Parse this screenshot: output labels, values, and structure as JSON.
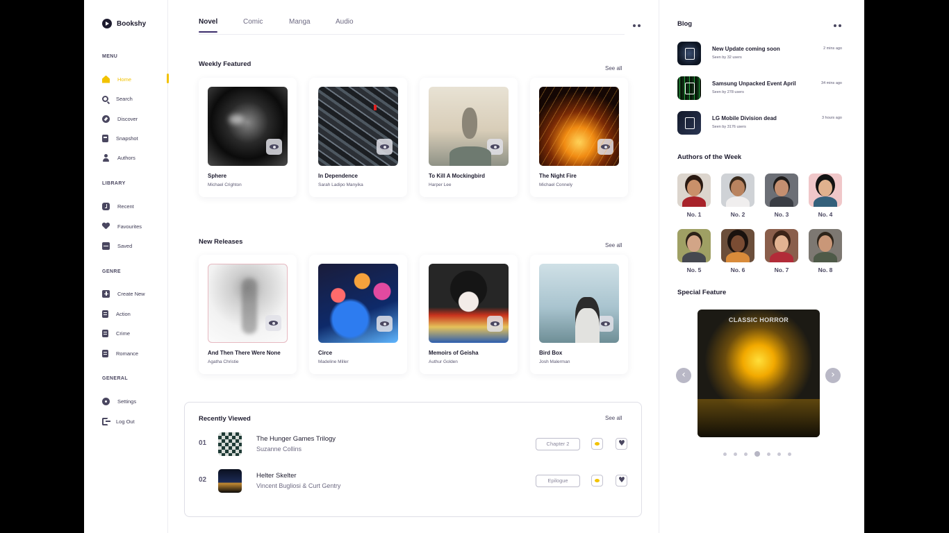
{
  "app": {
    "brand": "Bookshy"
  },
  "sidebar": {
    "sections": [
      {
        "title": "MENU",
        "items": [
          {
            "label": "Home",
            "icon": "home-icon",
            "active": true
          },
          {
            "label": "Search",
            "icon": "search-icon"
          },
          {
            "label": "Discover",
            "icon": "compass-icon"
          },
          {
            "label": "Snapshot",
            "icon": "bookmark-icon"
          },
          {
            "label": "Authors",
            "icon": "user-icon"
          }
        ]
      },
      {
        "title": "LIBRARY",
        "items": [
          {
            "label": "Recent",
            "icon": "clock-icon"
          },
          {
            "label": "Favourites",
            "icon": "heart-icon"
          },
          {
            "label": "Saved",
            "icon": "save-icon"
          }
        ]
      },
      {
        "title": "GENRE",
        "items": [
          {
            "label": "Create New",
            "icon": "plus-icon"
          },
          {
            "label": "Action",
            "icon": "document-icon"
          },
          {
            "label": "Crime",
            "icon": "document-icon"
          },
          {
            "label": "Romance",
            "icon": "document-icon"
          }
        ]
      },
      {
        "title": "GENERAL",
        "items": [
          {
            "label": "Settings",
            "icon": "gear-icon"
          },
          {
            "label": "Log Out",
            "icon": "logout-icon"
          }
        ]
      }
    ]
  },
  "tabs": [
    {
      "label": "Novel",
      "active": true
    },
    {
      "label": "Comic"
    },
    {
      "label": "Manga"
    },
    {
      "label": "Audio"
    }
  ],
  "weekly": {
    "title": "Weekly Featured",
    "see_all": "See all",
    "books": [
      {
        "title": "Sphere",
        "author": "Michael Crighton"
      },
      {
        "title": "In Dependence",
        "author": "Sarah Ladipo Manyika"
      },
      {
        "title": "To Kill A Mockingbird",
        "author": "Harper Lee"
      },
      {
        "title": "The Night Fire",
        "author": "Michael Connely"
      }
    ]
  },
  "releases": {
    "title": "New Releases",
    "see_all": "See all",
    "books": [
      {
        "title": "And Then There Were None",
        "author": "Agatha Christie"
      },
      {
        "title": "Circe",
        "author": "Madeline Miller"
      },
      {
        "title": "Memoirs of Geisha",
        "author": "Authur Golden"
      },
      {
        "title": "Bird Box",
        "author": "Josh Malerman"
      }
    ]
  },
  "recent": {
    "title": "Recently Viewed",
    "see_all": "See all",
    "items": [
      {
        "num": "01",
        "title": "The Hunger Games Trilogy",
        "author": "Suzanne Collins",
        "progress": "Chapter 2"
      },
      {
        "num": "02",
        "title": "Helter Skelter",
        "author": "Vincent Bugliosi & Curt Gentry",
        "progress": "Epilogue"
      }
    ]
  },
  "blog": {
    "title": "Blog",
    "posts": [
      {
        "title": "New Update coming soon",
        "seen": "Seen by 32 users",
        "time": "2 mins ago"
      },
      {
        "title": "Samsung Unpacked Event April",
        "seen": "Seen by 278 users",
        "time": "34 mins ago"
      },
      {
        "title": "LG Mobile Division dead",
        "seen": "Seen by 3176 users",
        "time": "3 hours ago"
      }
    ]
  },
  "authors": {
    "title": "Authors of the Week",
    "list": [
      "No. 1",
      "No. 2",
      "No. 3",
      "No. 4",
      "No. 5",
      "No. 6",
      "No. 7",
      "No. 8"
    ]
  },
  "special": {
    "title": "Special Feature",
    "label": "CLASSIC HORROR",
    "slide_count": 7,
    "active_slide": 4
  },
  "colors": {
    "accent": "#f2c200",
    "text": "#1d1b2e",
    "muted": "#5b5872"
  }
}
